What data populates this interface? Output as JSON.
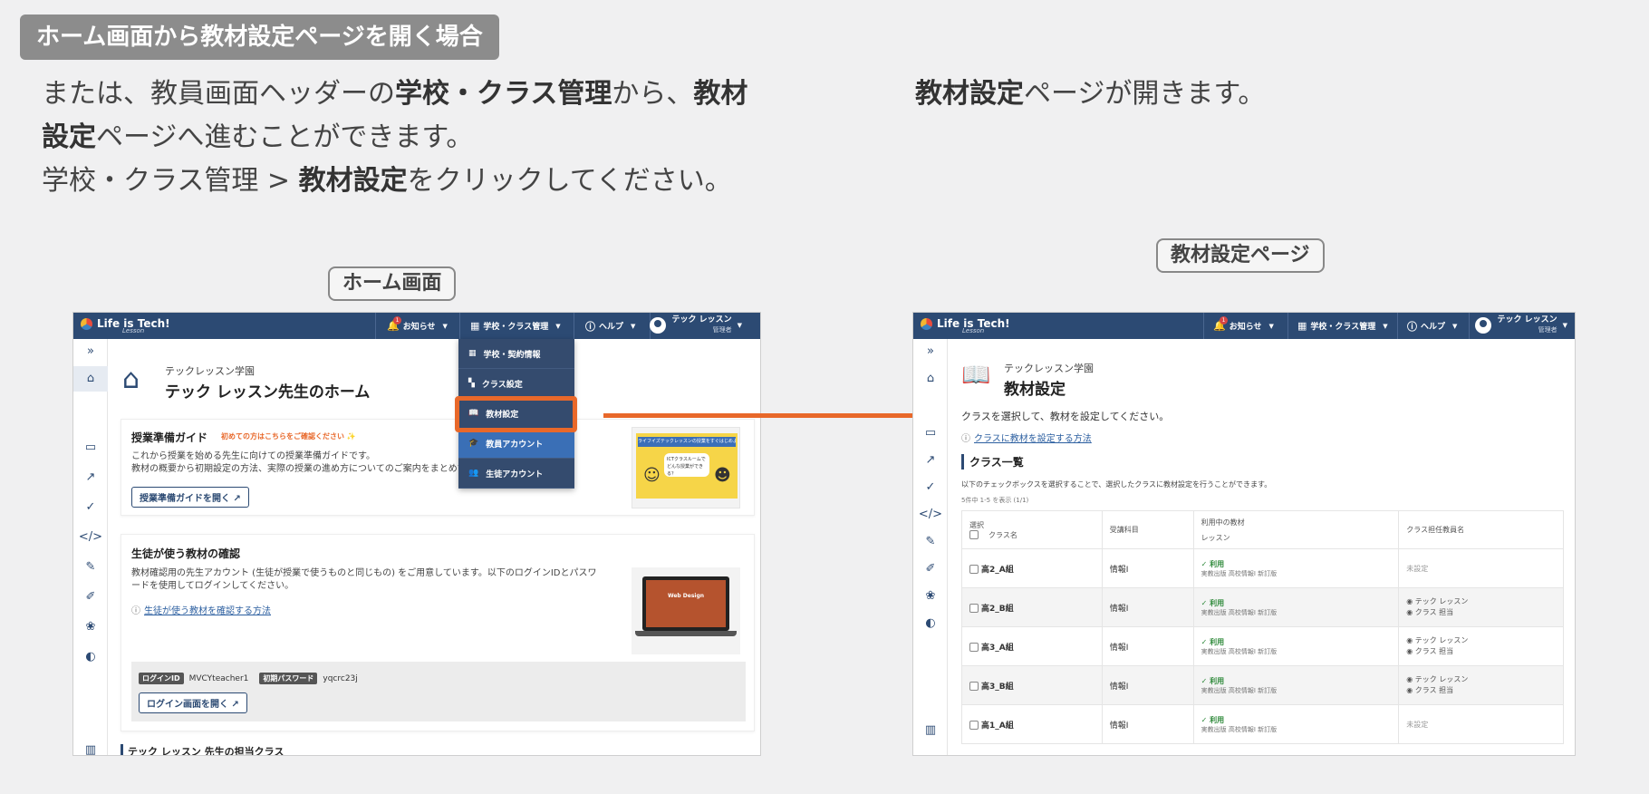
{
  "header_tag": "ホーム画面から教材設定ページを開く場合",
  "instructions_left": {
    "l1a": "または、教員画面ヘッダーの",
    "l1b": "学校・クラス管理",
    "l1c": "から、",
    "l1d": "教材",
    "l2a": "設定",
    "l2b": "ページへ進むことができます。",
    "l3a": "学校・クラス管理 > ",
    "l3b": "教材設定",
    "l3c": "をクリックしてください。"
  },
  "instructions_right": {
    "a": "教材設定",
    "b": "ページが開きます。"
  },
  "captions": {
    "home": "ホーム画面",
    "settings": "教材設定ページ"
  },
  "topbar": {
    "logo": "Life is Tech!",
    "logo_sub": "Lesson",
    "notice": "お知らせ",
    "notice_badge": "1",
    "school_mgmt": "学校・クラス管理",
    "help": "ヘルプ",
    "user_name_1": "テック レッスン",
    "user_role": "管理者"
  },
  "home": {
    "school": "テックレッスン学園",
    "title": "テック レッスン先生のホーム",
    "guide": {
      "title": "授業準備ガイド",
      "note": "初めての方はこちらをご確認ください ✨",
      "text1": "これから授業を始める先生に向けての授業準備ガイドです。",
      "text2": "教材の概要から初期設定の方法、実際の授業の進め方についてのご案内をまとめています。",
      "button": "授業準備ガイドを開く",
      "thumb_banner": "ライフイズテックレッスンの授業をすぐはじめよう！",
      "thumb_bubble": "ICTクラスルームでどんな授業ができる？"
    },
    "student": {
      "title": "生徒が使う教材の確認",
      "text1": "教材確認用の先生アカウント (生徒が授業で使うものと同じもの) をご用意しています。以下のログインIDとパスワ",
      "text2": "ードを使用してログインしてください。",
      "link": "生徒が使う教材を確認する方法",
      "login_id_label": "ログインID",
      "login_id": "MVCYteacher1",
      "password_label": "初期パスワード",
      "password": "yqcrc23j",
      "login_button": "ログイン画面を開く",
      "laptop_label": "Web Design"
    },
    "classes_heading": "テック レッスン 先生の担当クラス"
  },
  "dropdown": [
    {
      "icon": "building-icon",
      "label": "学校・契約情報"
    },
    {
      "icon": "grid-icon",
      "label": "クラス設定"
    },
    {
      "icon": "book-icon",
      "label": "教材設定"
    },
    {
      "icon": "graduation-icon",
      "label": "教員アカウント"
    },
    {
      "icon": "users-icon",
      "label": "生徒アカウント"
    }
  ],
  "settings": {
    "school": "テックレッスン学園",
    "title": "教材設定",
    "instruction": "クラスを選択して、教材を設定してください。",
    "help_link": "クラスに教材を設定する方法",
    "list_heading": "クラス一覧",
    "list_note": "以下のチェックボックスを選択することで、選択したクラスに教材設定を行うことができます。",
    "count": "5件中 1-5 を表示 (1/1)",
    "columns": {
      "select": "選択",
      "class_name": "クラス名",
      "subject": "受講科目",
      "material_1": "利用中の教材",
      "material_2": "レッスン",
      "teacher": "クラス担任教員名"
    },
    "rows": [
      {
        "name": "高2_A組",
        "subject": "情報I",
        "status": "利用",
        "pub": "実教出版 高校情報I 新訂版",
        "teacher1": "未設定",
        "teacher2": ""
      },
      {
        "name": "高2_B組",
        "subject": "情報I",
        "status": "利用",
        "pub": "実教出版 高校情報I 新訂版",
        "teacher1": "テック レッスン",
        "teacher2": "クラス 担当"
      },
      {
        "name": "高3_A組",
        "subject": "情報I",
        "status": "利用",
        "pub": "実教出版 高校情報I 新訂版",
        "teacher1": "テック レッスン",
        "teacher2": "クラス 担当"
      },
      {
        "name": "高3_B組",
        "subject": "情報I",
        "status": "利用",
        "pub": "実教出版 高校情報I 新訂版",
        "teacher1": "テック レッスン",
        "teacher2": "クラス 担当"
      },
      {
        "name": "高1_A組",
        "subject": "情報I",
        "status": "利用",
        "pub": "実教出版 高校情報I 新訂版",
        "teacher1": "未設定",
        "teacher2": ""
      }
    ]
  },
  "colors": {
    "navy": "#2c4a73",
    "highlight": "#e8682a",
    "dropdown_active": "#3a6fb6"
  }
}
